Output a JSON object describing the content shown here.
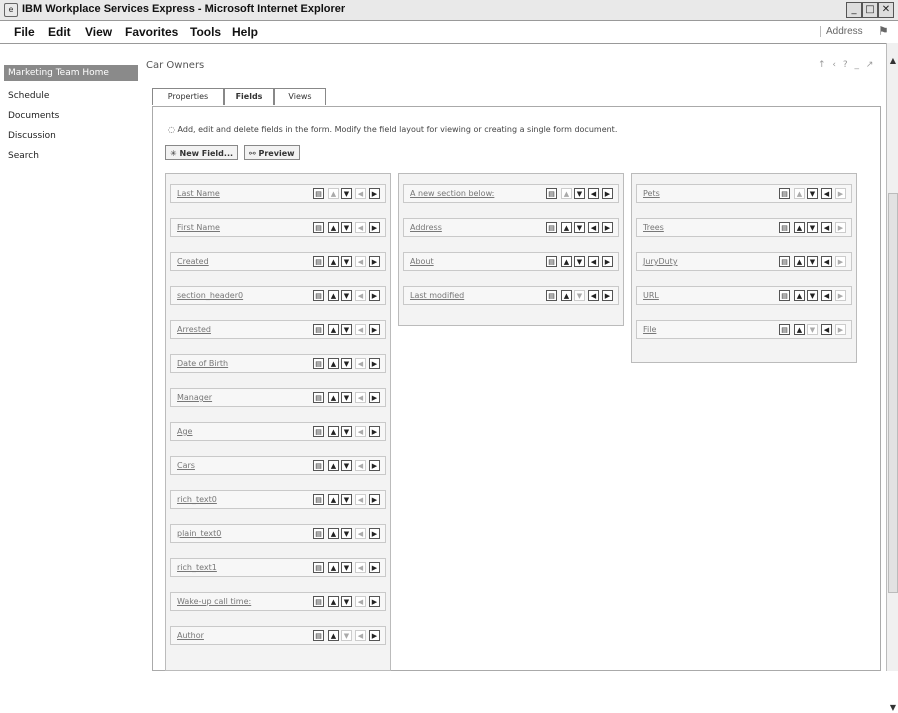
{
  "window": {
    "title": "IBM Workplace Services Express - Microsoft Internet Explorer",
    "ie_icon": "ie-icon",
    "min_label": "_",
    "max_label": "□",
    "close_label": "✕"
  },
  "menubar": {
    "items": [
      "File",
      "Edit",
      "View",
      "Favorites",
      "Tools",
      "Help"
    ],
    "address_label": "Address"
  },
  "sidebar": {
    "home_label": "Marketing Team Home",
    "items": [
      "Schedule",
      "Documents",
      "Discussion",
      "Search"
    ]
  },
  "page": {
    "title": "Car Owners",
    "tools": "↑ ‹ ? _ ↗",
    "tabs": [
      "Properties",
      "Fields",
      "Views"
    ],
    "active_tab": "Fields",
    "instructions": "Add, edit and delete fields in the form. Modify the field layout for viewing or creating a single form document.",
    "new_field_button": "New Field...",
    "preview_button": "Preview"
  },
  "columns": [
    {
      "fields": [
        {
          "label": "Last Name",
          "controls": [
            1,
            0,
            1,
            0,
            1
          ]
        },
        {
          "label": "First Name",
          "controls": [
            1,
            1,
            1,
            0,
            1
          ]
        },
        {
          "label": "Created",
          "controls": [
            1,
            1,
            1,
            0,
            1
          ]
        },
        {
          "label": "section_header0",
          "controls": [
            1,
            1,
            1,
            0,
            1
          ]
        },
        {
          "label": "Arrested",
          "controls": [
            1,
            1,
            1,
            0,
            1
          ]
        },
        {
          "label": "Date of Birth",
          "controls": [
            1,
            1,
            1,
            0,
            1
          ]
        },
        {
          "label": "Manager",
          "controls": [
            1,
            1,
            1,
            0,
            1
          ]
        },
        {
          "label": "Age",
          "controls": [
            1,
            1,
            1,
            0,
            1
          ]
        },
        {
          "label": "Cars",
          "controls": [
            1,
            1,
            1,
            0,
            1
          ]
        },
        {
          "label": "rich_text0",
          "controls": [
            1,
            1,
            1,
            0,
            1
          ]
        },
        {
          "label": "plain_text0",
          "controls": [
            1,
            1,
            1,
            0,
            1
          ]
        },
        {
          "label": "rich_text1",
          "controls": [
            1,
            1,
            1,
            0,
            1
          ]
        },
        {
          "label": "Wake-up call time:",
          "controls": [
            1,
            1,
            1,
            0,
            1
          ]
        },
        {
          "label": "Author",
          "controls": [
            1,
            1,
            0,
            0,
            1
          ]
        }
      ]
    },
    {
      "fields": [
        {
          "label": "A new section below:",
          "controls": [
            1,
            0,
            1,
            1,
            1
          ]
        },
        {
          "label": "Address",
          "controls": [
            1,
            1,
            1,
            1,
            1
          ]
        },
        {
          "label": "About",
          "controls": [
            1,
            1,
            1,
            1,
            1
          ]
        },
        {
          "label": "Last modified",
          "controls": [
            1,
            1,
            0,
            1,
            1
          ]
        }
      ]
    },
    {
      "fields": [
        {
          "label": "Pets",
          "controls": [
            1,
            0,
            1,
            1,
            0
          ]
        },
        {
          "label": "Trees",
          "controls": [
            1,
            1,
            1,
            1,
            0
          ]
        },
        {
          "label": "JuryDuty",
          "controls": [
            1,
            1,
            1,
            1,
            0
          ]
        },
        {
          "label": "URL",
          "controls": [
            1,
            1,
            1,
            1,
            0
          ]
        },
        {
          "label": "File",
          "controls": [
            1,
            1,
            0,
            1,
            0
          ]
        }
      ]
    }
  ],
  "controls": {
    "names": [
      "trash-icon",
      "move-up-icon",
      "move-down-icon",
      "move-left-icon",
      "move-right-icon"
    ],
    "glyphs": [
      "▤",
      "▲",
      "▼",
      "◀",
      "▶"
    ]
  },
  "colors": {
    "sidebar_active_bg": "#8a8a8a",
    "column_bg": "#f3f3f3",
    "link_color": "#777777"
  }
}
